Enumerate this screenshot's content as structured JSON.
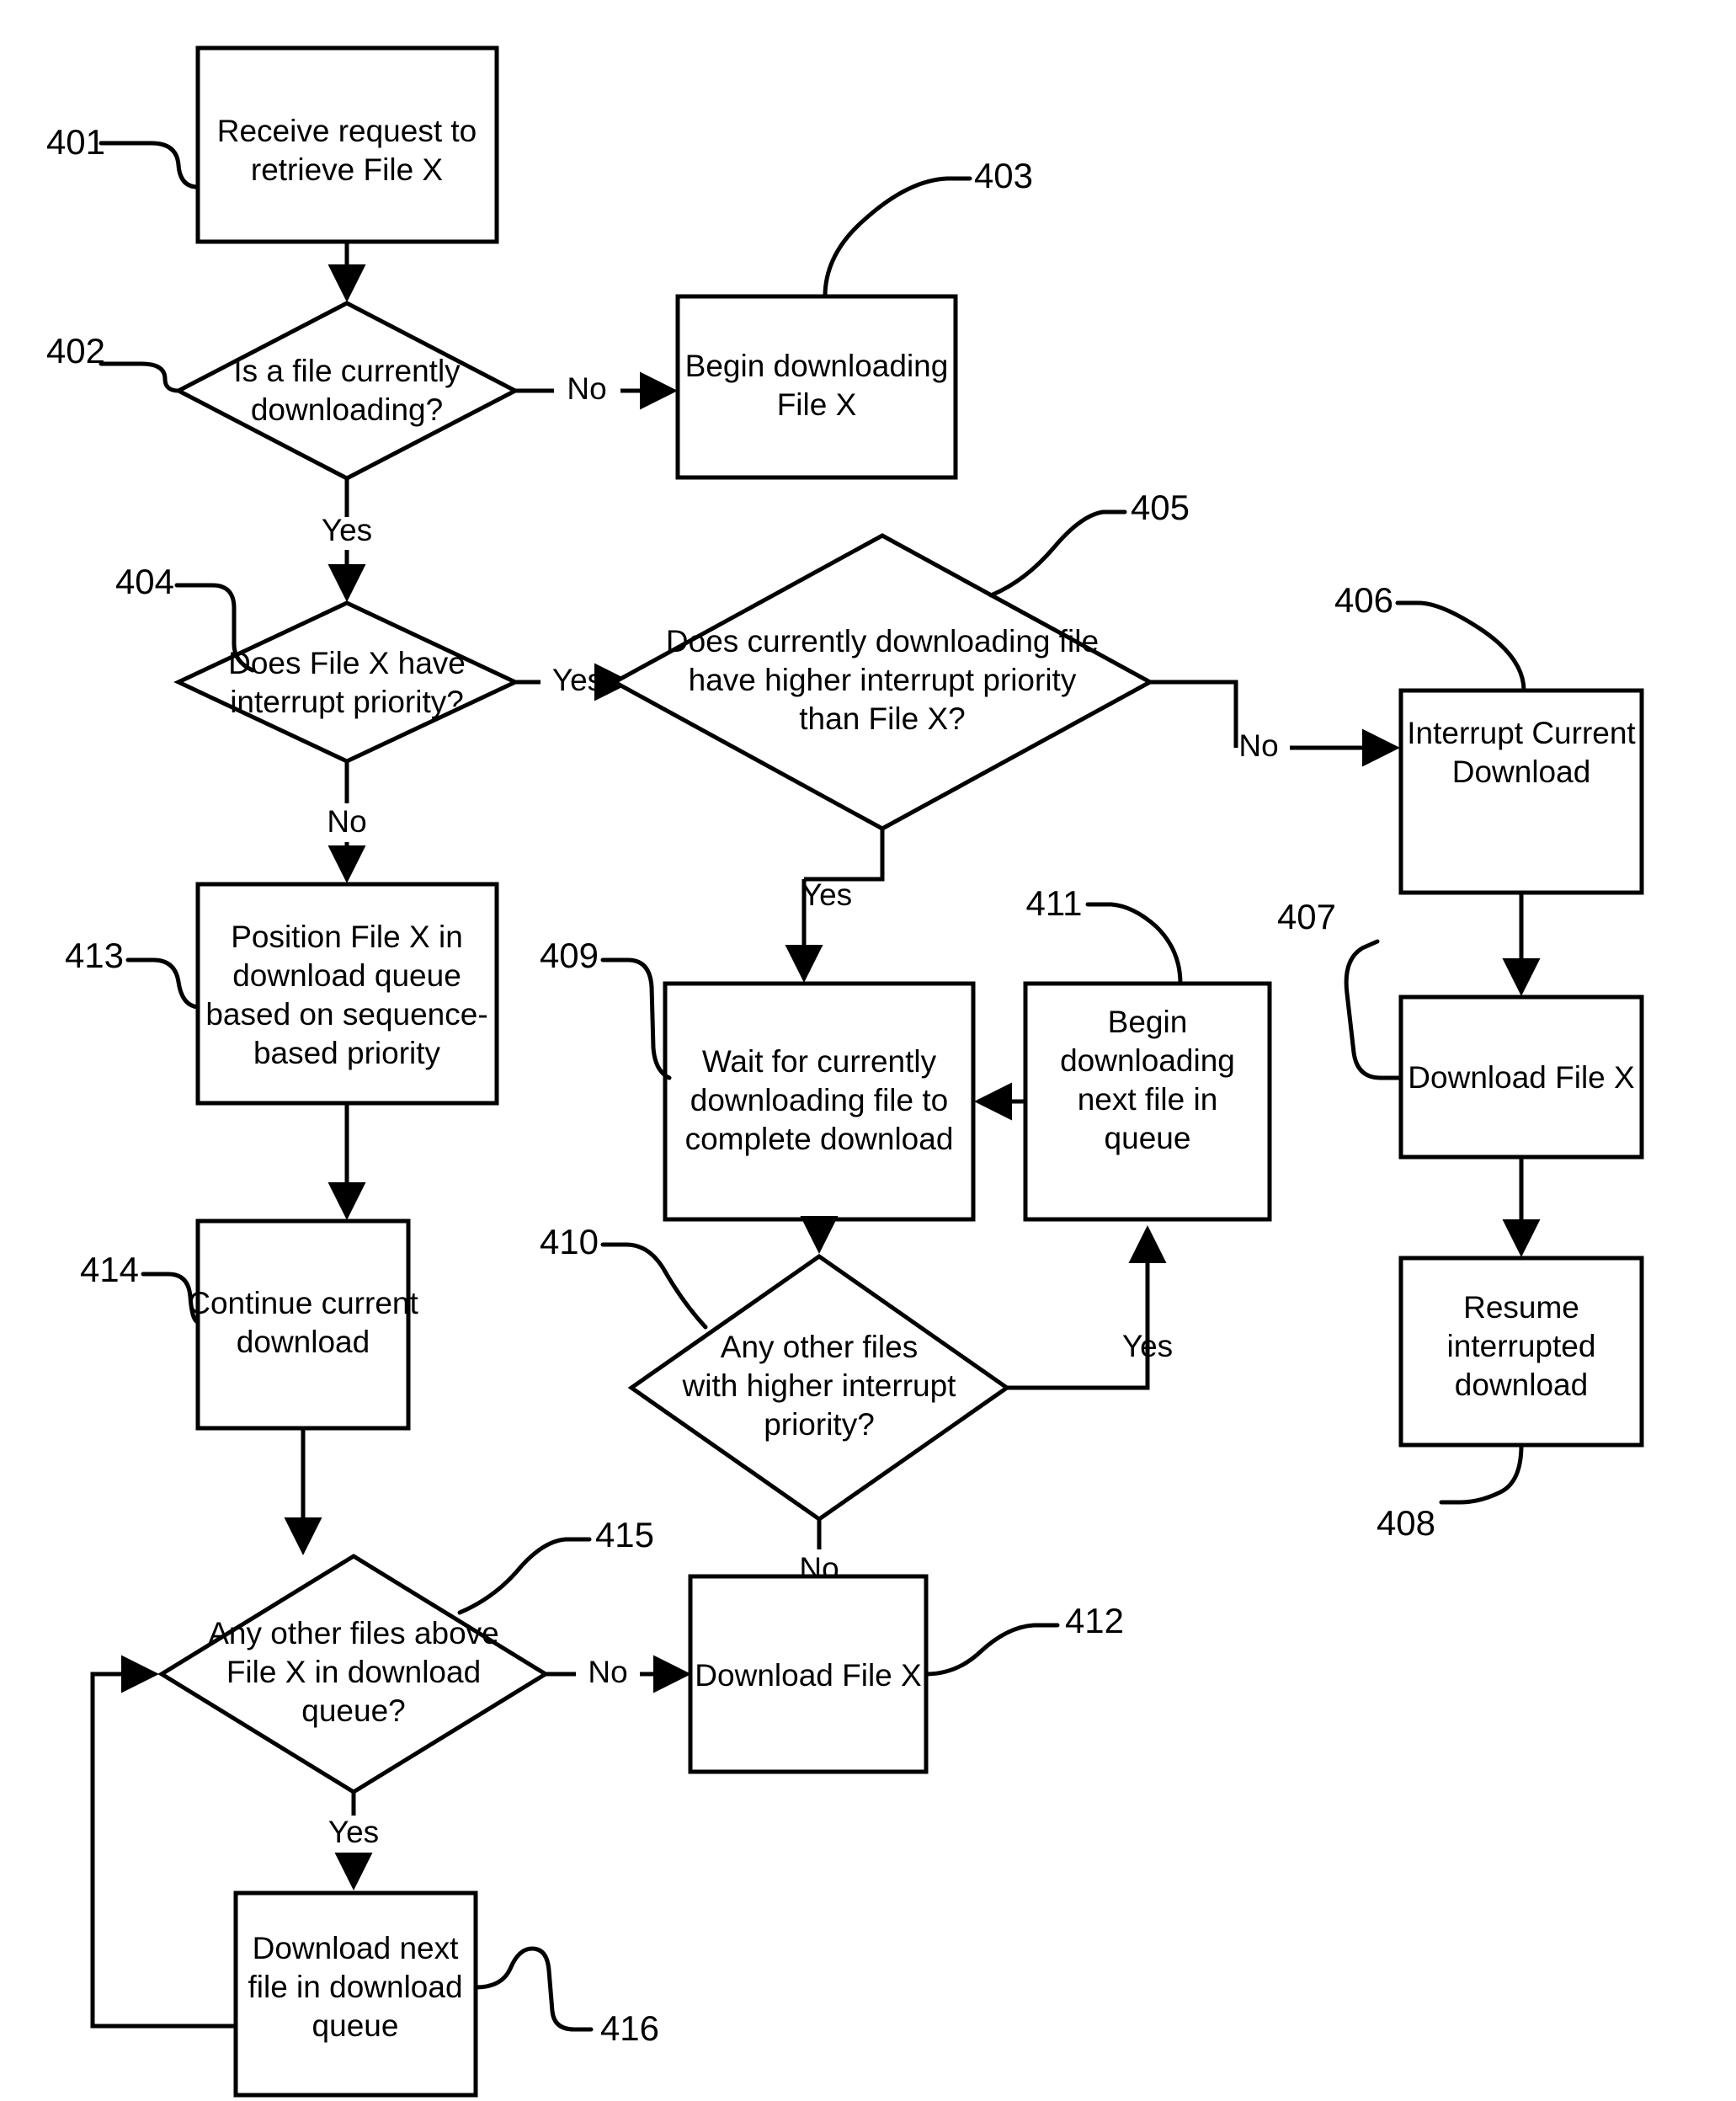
{
  "diagram": {
    "type": "flowchart",
    "title": "File download interrupt-priority flowchart",
    "nodes": [
      {
        "ref": "401",
        "shape": "process",
        "lines": [
          "Receive request to",
          "retrieve File X"
        ]
      },
      {
        "ref": "402",
        "shape": "decision",
        "lines": [
          "Is a file currently",
          "downloading?"
        ]
      },
      {
        "ref": "403",
        "shape": "process",
        "lines": [
          "Begin downloading",
          "File X"
        ]
      },
      {
        "ref": "404",
        "shape": "decision",
        "lines": [
          "Does File X have",
          "interrupt priority?"
        ]
      },
      {
        "ref": "405",
        "shape": "decision",
        "lines": [
          "Does currently downloading file",
          "have higher interrupt priority",
          "than File X?"
        ]
      },
      {
        "ref": "406",
        "shape": "process",
        "lines": [
          "Interrupt Current",
          "Download"
        ]
      },
      {
        "ref": "407",
        "shape": "process",
        "lines": [
          "Download File X"
        ]
      },
      {
        "ref": "408",
        "shape": "process",
        "lines": [
          "Resume",
          "interrupted",
          "download"
        ]
      },
      {
        "ref": "409",
        "shape": "process",
        "lines": [
          "Wait for currently",
          "downloading file to",
          "complete download"
        ]
      },
      {
        "ref": "410",
        "shape": "decision",
        "lines": [
          "Any other files",
          "with higher interrupt",
          "priority?"
        ]
      },
      {
        "ref": "411",
        "shape": "process",
        "lines": [
          "Begin",
          "downloading",
          "next file in",
          "queue"
        ]
      },
      {
        "ref": "412",
        "shape": "process",
        "lines": [
          "Download File X"
        ]
      },
      {
        "ref": "413",
        "shape": "process",
        "lines": [
          "Position File X in",
          "download queue",
          "based on sequence-",
          "based priority"
        ]
      },
      {
        "ref": "414",
        "shape": "process",
        "lines": [
          "Continue current",
          "download"
        ]
      },
      {
        "ref": "415",
        "shape": "decision",
        "lines": [
          "Any other files above",
          "File X in download",
          "queue?"
        ]
      },
      {
        "ref": "416",
        "shape": "process",
        "lines": [
          "Download next",
          "file in download",
          "queue"
        ]
      }
    ],
    "edge_labels": {
      "e402_no": "No",
      "e402_yes": "Yes",
      "e404_yes": "Yes",
      "e404_no": "No",
      "e405_no": "No",
      "e405_yes": "Yes",
      "e410_yes": "Yes",
      "e410_no": "No",
      "e415_no": "No",
      "e415_yes": "Yes"
    },
    "colors": {
      "stroke": "#000000",
      "fill": "#ffffff",
      "background": "#ffffff"
    }
  }
}
